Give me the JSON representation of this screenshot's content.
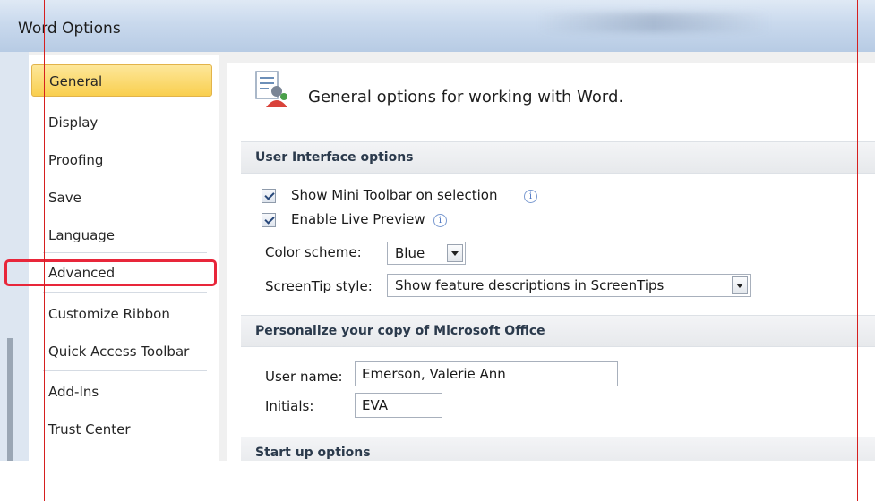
{
  "window": {
    "title": "Word Options"
  },
  "sidebar": {
    "items": [
      {
        "label": "General"
      },
      {
        "label": "Display"
      },
      {
        "label": "Proofing"
      },
      {
        "label": "Save"
      },
      {
        "label": "Language"
      },
      {
        "label": "Advanced"
      },
      {
        "label": "Customize Ribbon"
      },
      {
        "label": "Quick Access Toolbar"
      },
      {
        "label": "Add-Ins"
      },
      {
        "label": "Trust Center"
      }
    ],
    "selected": "General",
    "highlighted": "Advanced"
  },
  "main": {
    "header": "General options for working with Word.",
    "ui_options": {
      "title": "User Interface options",
      "mini_toolbar": {
        "label": "Show Mini Toolbar on selection",
        "checked": true
      },
      "live_preview": {
        "label": "Enable Live Preview",
        "checked": true
      },
      "color_scheme": {
        "label": "Color scheme:",
        "value": "Blue"
      },
      "screentip_style": {
        "label": "ScreenTip style:",
        "value": "Show feature descriptions in ScreenTips"
      }
    },
    "personalize": {
      "title": "Personalize your copy of Microsoft Office",
      "user_name": {
        "label": "User name:",
        "value": "Emerson, Valerie Ann"
      },
      "initials": {
        "label": "Initials:",
        "value": "EVA"
      }
    },
    "startup": {
      "title": "Start up options"
    }
  },
  "colors": {
    "highlight": "#e8263a",
    "selected_bg": "#f9cf4f",
    "guide_line": "#d61f1f"
  }
}
